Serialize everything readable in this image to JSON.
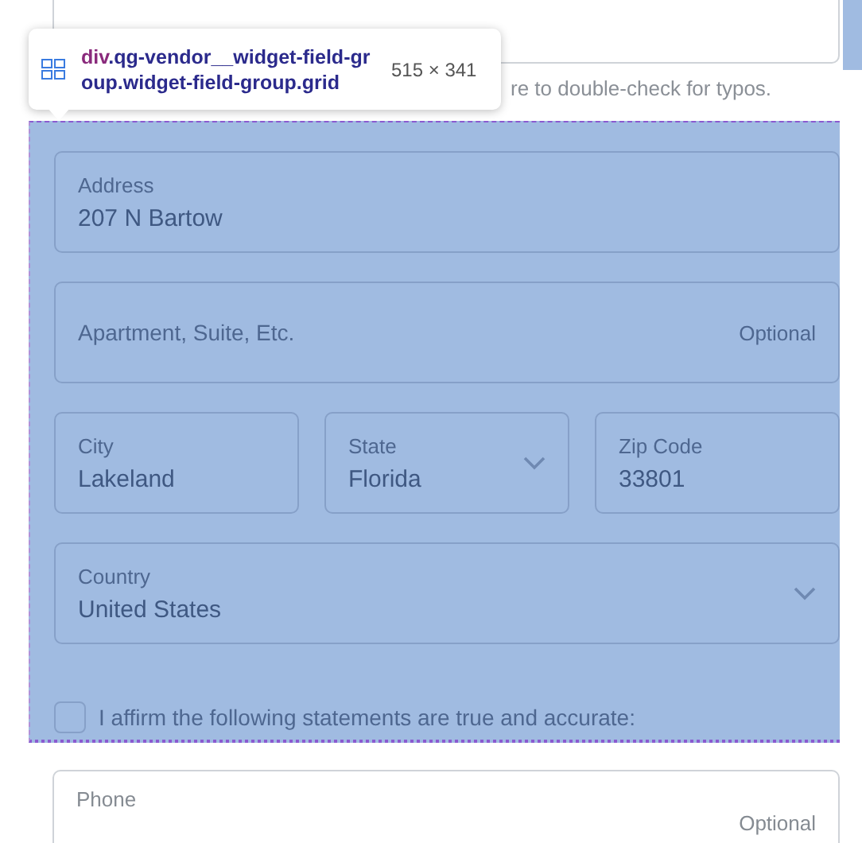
{
  "email_field": {
    "kind": "text"
  },
  "hint": "re to double-check for typos.",
  "inspector_tooltip": {
    "tag": "div",
    "classes": ".qg-vendor__widget-field-group.widget-field-group.grid",
    "size": "515 × 341"
  },
  "field_group": {
    "highlighted": true,
    "rows": [
      {
        "fields": [
          {
            "kind": "text",
            "label": "Address",
            "value": "207 N Bartow"
          }
        ]
      },
      {
        "fields": [
          {
            "kind": "optional",
            "placeholder": "Apartment, Suite, Etc.",
            "note": "Optional"
          }
        ]
      },
      {
        "fields": [
          {
            "kind": "text",
            "label": "City",
            "value": "Lakeland"
          },
          {
            "kind": "select",
            "label": "State",
            "value": "Florida"
          },
          {
            "kind": "text",
            "label": "Zip Code",
            "value": "33801"
          }
        ]
      },
      {
        "fields": [
          {
            "kind": "select",
            "label": "Country",
            "value": "United States"
          }
        ]
      }
    ],
    "affirm": {
      "label": "I affirm the following statements are true and accurate:",
      "checked": false
    }
  },
  "phone_field": {
    "label": "Phone",
    "note": "Optional"
  }
}
